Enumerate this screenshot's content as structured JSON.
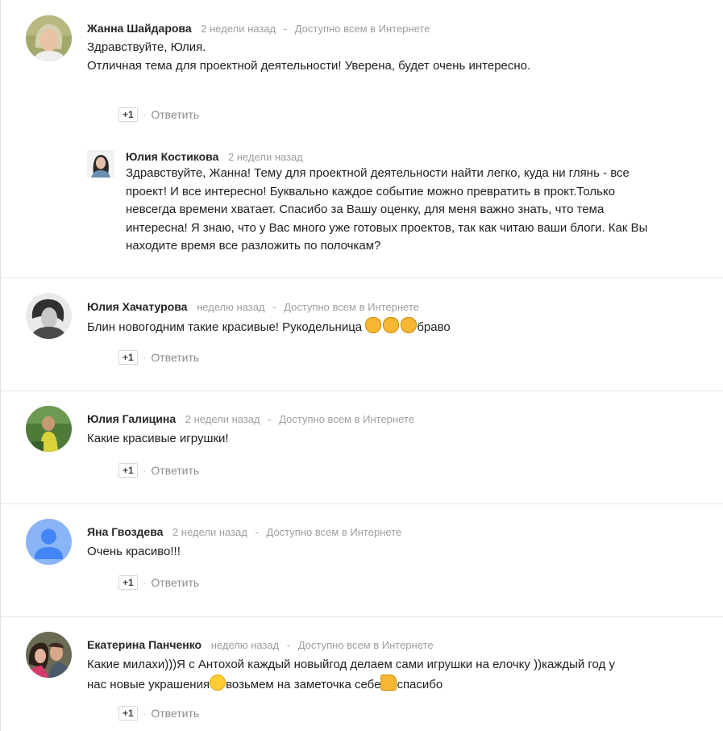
{
  "comments": [
    {
      "author": "Жанна Шайдарова",
      "time": "2 недели назад",
      "sep": "-",
      "visibility": "Доступно всем в Интернете",
      "text": "Здравствуйте, Юлия.\nОтличная тема для проектной деятельности! Уверена, будет очень интересно.",
      "plus": "+1",
      "reply": "Ответить"
    },
    {
      "author": "Юлия Костикова",
      "time": "2 недели назад",
      "text": "Здравствуйте, Жанна! Тему для проектной деятельности найти легко, куда ни глянь - все\nпроект! И все интересно! Буквально каждое событие можно превратить в прокт.Только\nневсегда времени хватает. Спасибо за Вашу оценку, для меня важно знать, что тема\nинтересна! Я знаю, что у Вас много уже готовых проектов, так как читаю ваши блоги. Как Вы\nнаходите время все разложить по полочкам?"
    },
    {
      "author": "Юлия Хачатурова",
      "time": "неделю назад",
      "sep": "-",
      "visibility": "Доступно всем в Интернете",
      "text_before": "Блин новогодним такие красивые! Рукодельница ",
      "text_after": "браво",
      "plus": "+1",
      "reply": "Ответить"
    },
    {
      "author": "Юлия Галицина",
      "time": "2 недели назад",
      "sep": "-",
      "visibility": "Доступно всем в Интернете",
      "text": "Какие красивые игрушки!",
      "plus": "+1",
      "reply": "Ответить"
    },
    {
      "author": "Яна Гвоздева",
      "time": "2 недели назад",
      "sep": "-",
      "visibility": "Доступно всем в Интернете",
      "text": "Очень красиво!!!",
      "plus": "+1",
      "reply": "Ответить"
    },
    {
      "author": "Екатерина Панченко",
      "time": "неделю назад",
      "sep": "-",
      "visibility": "Доступно всем в Интернете",
      "text_line1": "Какие милахи)))Я с Антохой каждый новыйгод делаем сами игрушки на елочку ))каждый год у",
      "text_line2a": "нас новые украшения",
      "text_line2b": "возьмем на заметочка себе",
      "text_line2c": "спасибо",
      "plus": "+1",
      "reply": "Ответить"
    }
  ],
  "dot": "·",
  "icons": {
    "clap": "clapping-hands-emoji",
    "smile": "smiling-face-emoji",
    "thumb": "thumbs-up-emoji",
    "default_avatar": "default-user-avatar-icon"
  },
  "colors": {
    "default_avatar_bg": "#8ab4f8",
    "default_avatar_fg": "#4285f4"
  }
}
